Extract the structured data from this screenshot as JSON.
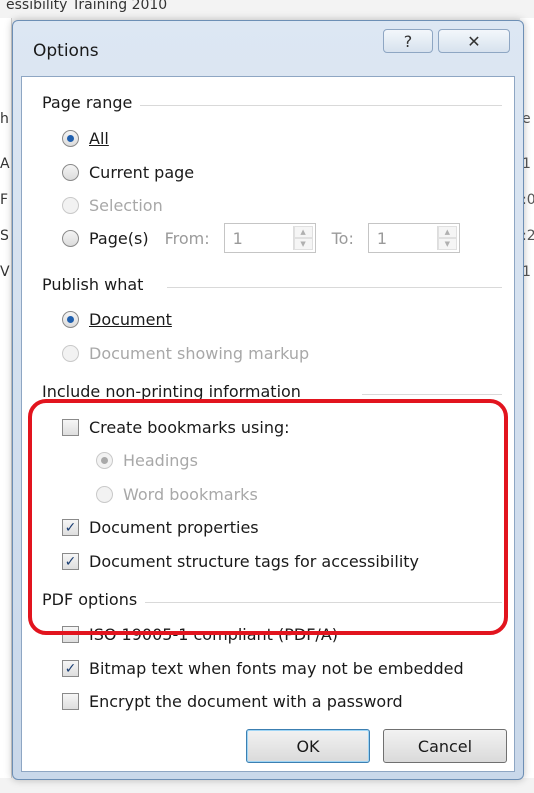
{
  "background": {
    "title_text": "essibility Training 2010",
    "left_fragments": [
      "h",
      "A",
      "F",
      "S",
      "V"
    ],
    "right_fragments": [
      "e",
      "1",
      ":0",
      ":2",
      "1"
    ]
  },
  "dialog": {
    "title": "Options",
    "help_glyph": "?",
    "close_glyph": "✕"
  },
  "page_range": {
    "title": "Page range",
    "all": "All",
    "current_page": "Current page",
    "selection": "Selection",
    "pages": "Page(s)",
    "from_label": "From:",
    "from_value": "1",
    "to_label": "To:",
    "to_value": "1"
  },
  "publish_what": {
    "title": "Publish what",
    "document": "Document",
    "document_markup": "Document showing markup"
  },
  "non_printing": {
    "title": "Include non-printing information",
    "create_bookmarks": "Create bookmarks using:",
    "headings": "Headings",
    "word_bookmarks": "Word bookmarks",
    "doc_properties": "Document properties",
    "structure_tags": "Document structure tags for accessibility"
  },
  "pdf_options": {
    "title": "PDF options",
    "iso": "ISO 19005-1 compliant (PDF/A)",
    "bitmap": "Bitmap text when fonts may not be embedded",
    "encrypt": "Encrypt the document with a password"
  },
  "buttons": {
    "ok": "OK",
    "cancel": "Cancel"
  },
  "colors": {
    "highlight": "#e2141e",
    "accent": "#1f5fae"
  }
}
